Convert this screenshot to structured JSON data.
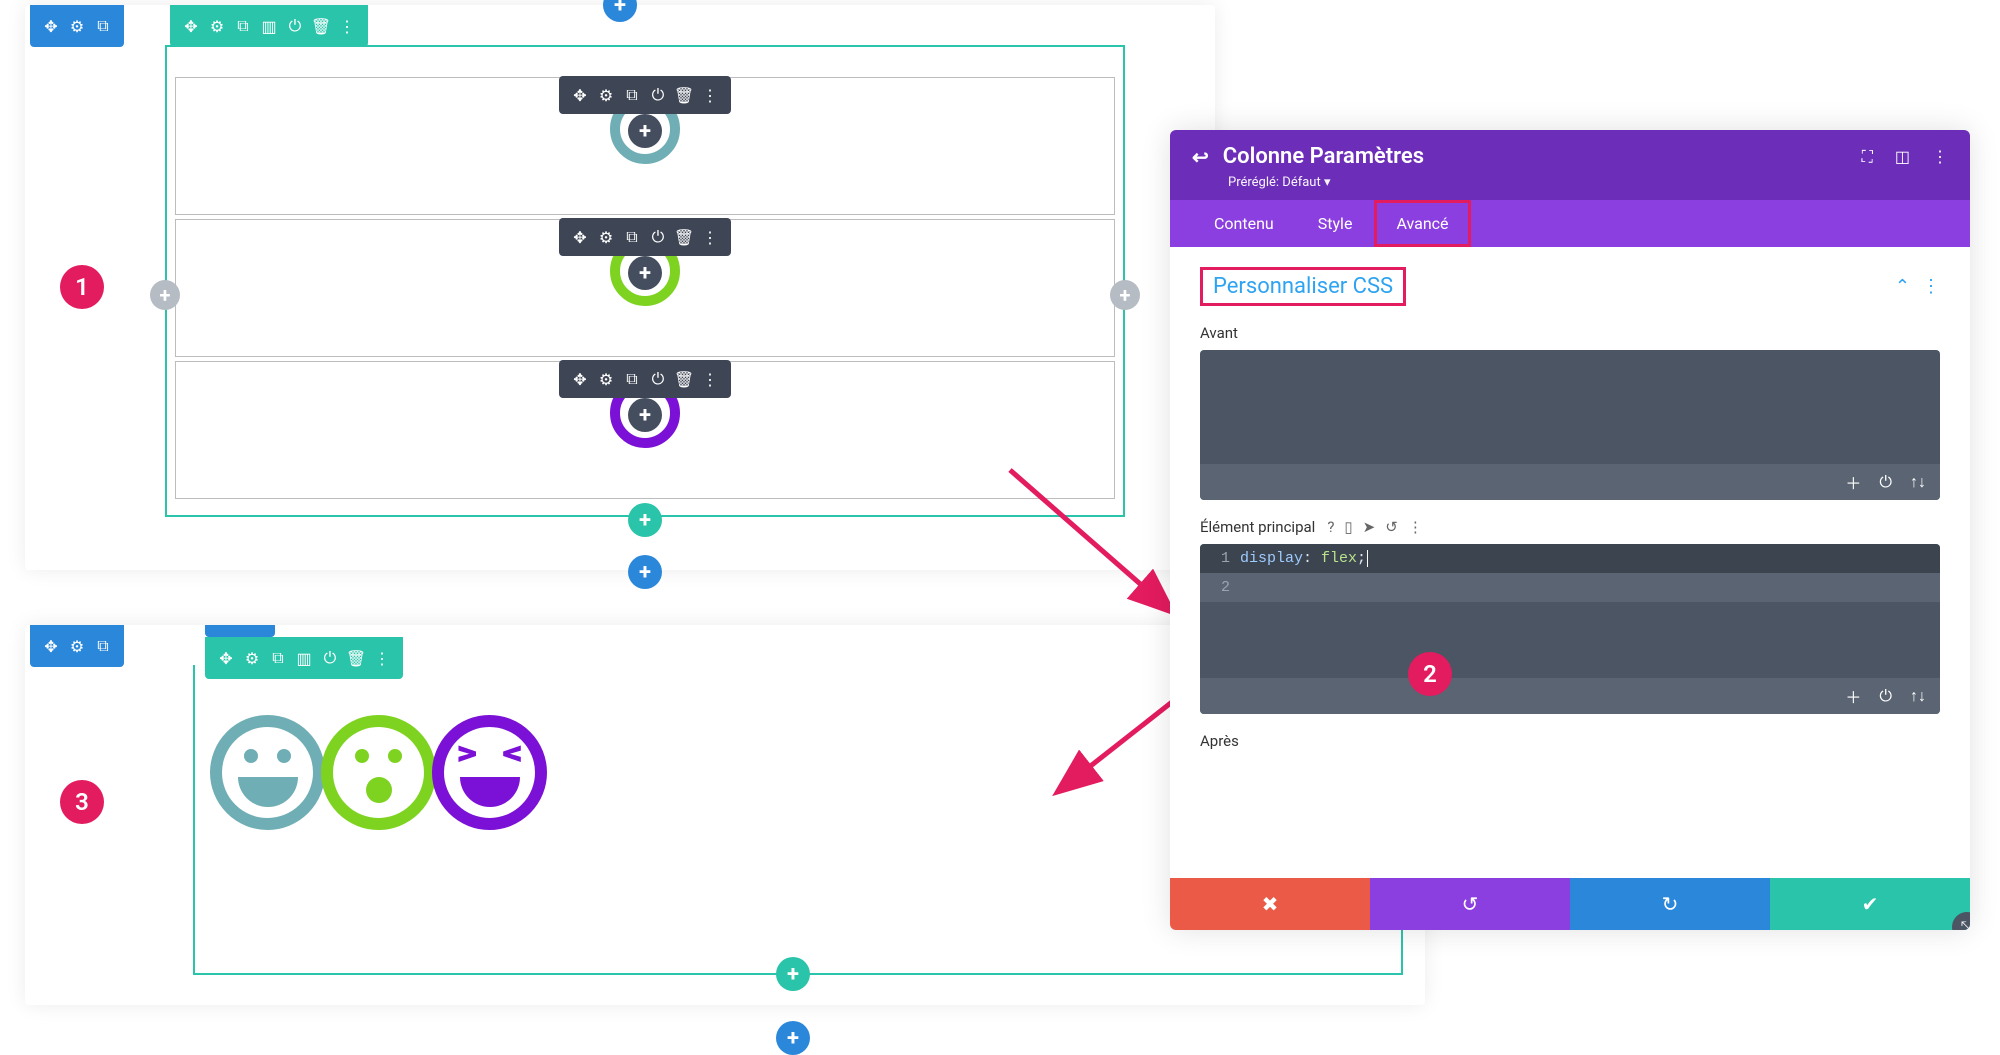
{
  "steps": {
    "one": "1",
    "two": "2",
    "three": "3"
  },
  "builder": {
    "section_icons": [
      "move",
      "gear",
      "duplicate"
    ],
    "row_icons": [
      "move",
      "gear",
      "duplicate",
      "columns",
      "power",
      "trash",
      "more"
    ],
    "module_icons": [
      "move",
      "gear",
      "duplicate",
      "power",
      "trash",
      "more"
    ],
    "add": "+"
  },
  "settings": {
    "title": "Colonne Paramètres",
    "preset_label": "Préréglé: Défaut",
    "preset_caret": "▾",
    "header_icons": [
      "fullscreen",
      "layout",
      "more"
    ],
    "tabs": {
      "content": "Contenu",
      "style": "Style",
      "advanced": "Avancé"
    },
    "section_title": "Personnaliser CSS",
    "section_controls": [
      "collapse",
      "more"
    ],
    "before_label": "Avant",
    "main_label": "Élément principal",
    "main_icons": [
      "help",
      "mobile",
      "cursor",
      "undo",
      "more"
    ],
    "after_label": "Après",
    "code_before": "",
    "code_main": [
      {
        "n": "1",
        "text": "display: flex;"
      },
      {
        "n": "2",
        "text": ""
      }
    ],
    "code_footer_icons": [
      "plus",
      "power",
      "sort"
    ],
    "footer_icons": [
      "close",
      "undo",
      "redo",
      "check"
    ]
  }
}
